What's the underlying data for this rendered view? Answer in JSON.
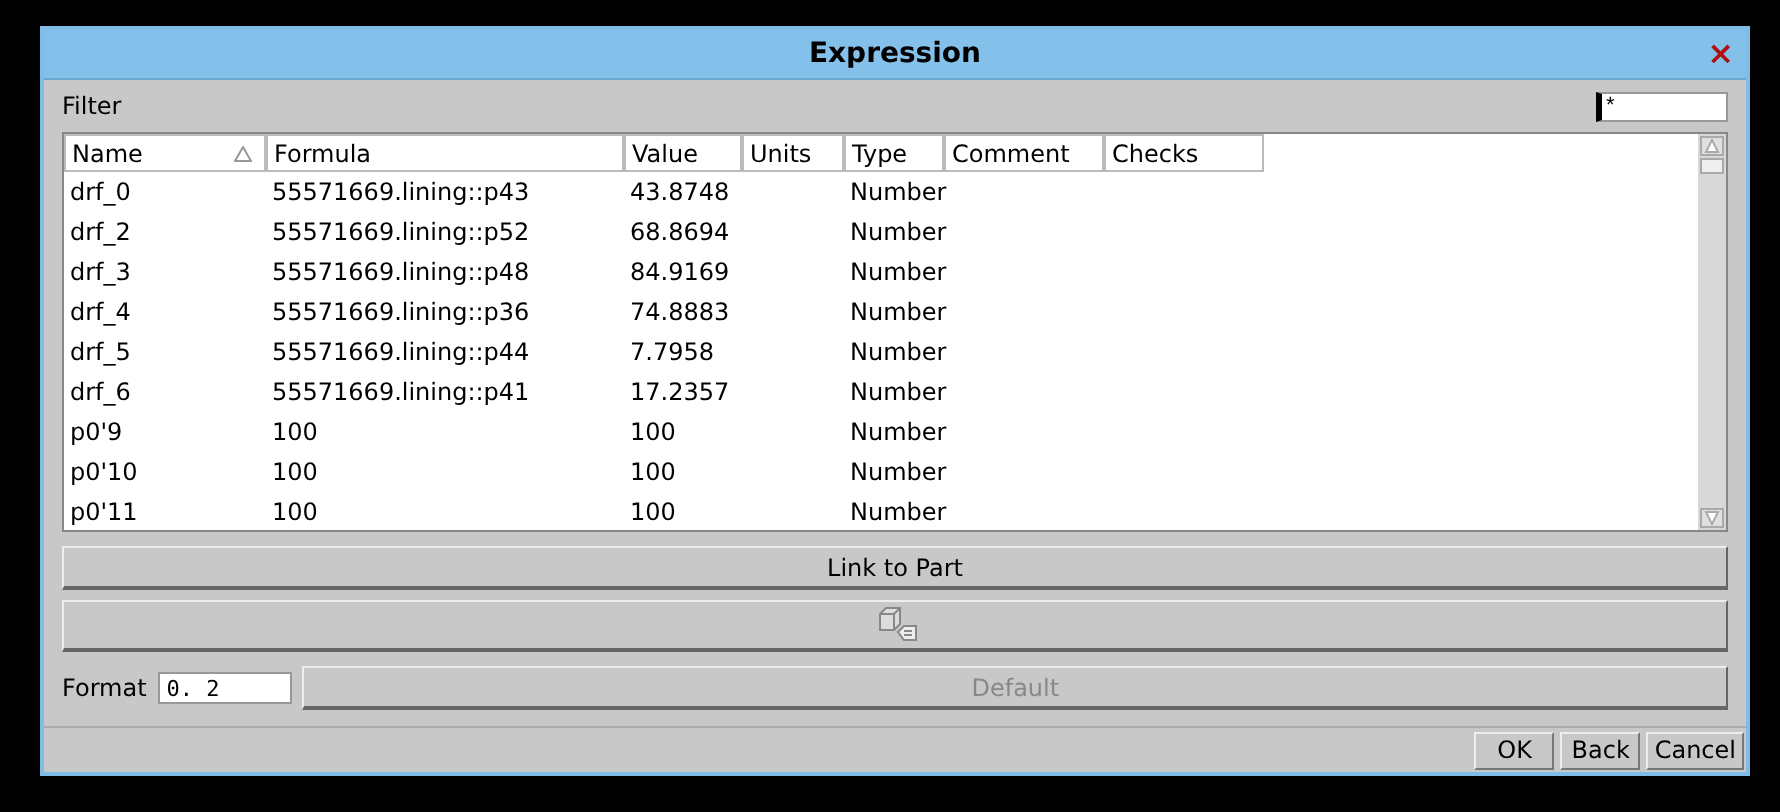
{
  "window": {
    "title": "Expression",
    "close": "×"
  },
  "filter": {
    "label": "Filter",
    "value": "*"
  },
  "table": {
    "columns": [
      {
        "label": "Name",
        "sorted": true
      },
      {
        "label": "Formula",
        "sorted": false
      },
      {
        "label": "Value",
        "sorted": false
      },
      {
        "label": "Units",
        "sorted": false
      },
      {
        "label": "Type",
        "sorted": false
      },
      {
        "label": "Comment",
        "sorted": false
      },
      {
        "label": "Checks",
        "sorted": false
      }
    ],
    "rows": [
      [
        "drf_0",
        "55571669.lining::p43",
        "43.8748",
        "",
        "Number",
        "",
        ""
      ],
      [
        "drf_2",
        "55571669.lining::p52",
        "68.8694",
        "",
        "Number",
        "",
        ""
      ],
      [
        "drf_3",
        "55571669.lining::p48",
        "84.9169",
        "",
        "Number",
        "",
        ""
      ],
      [
        "drf_4",
        "55571669.lining::p36",
        "74.8883",
        "",
        "Number",
        "",
        ""
      ],
      [
        "drf_5",
        "55571669.lining::p44",
        "7.7958",
        "",
        "Number",
        "",
        ""
      ],
      [
        "drf_6",
        "55571669.lining::p41",
        "17.2357",
        "",
        "Number",
        "",
        ""
      ],
      [
        "p0'9",
        "100",
        "100",
        "",
        "Number",
        "",
        ""
      ],
      [
        "p0'10",
        "100",
        "100",
        "",
        "Number",
        "",
        ""
      ],
      [
        "p0'11",
        "100",
        "100",
        "",
        "Number",
        "",
        ""
      ]
    ]
  },
  "link_button": {
    "label": "Link to Part"
  },
  "format": {
    "label": "Format",
    "value": "0. 2"
  },
  "default_button": {
    "label": "Default",
    "disabled": true
  },
  "buttons": [
    "OK",
    "Back",
    "Cancel"
  ]
}
